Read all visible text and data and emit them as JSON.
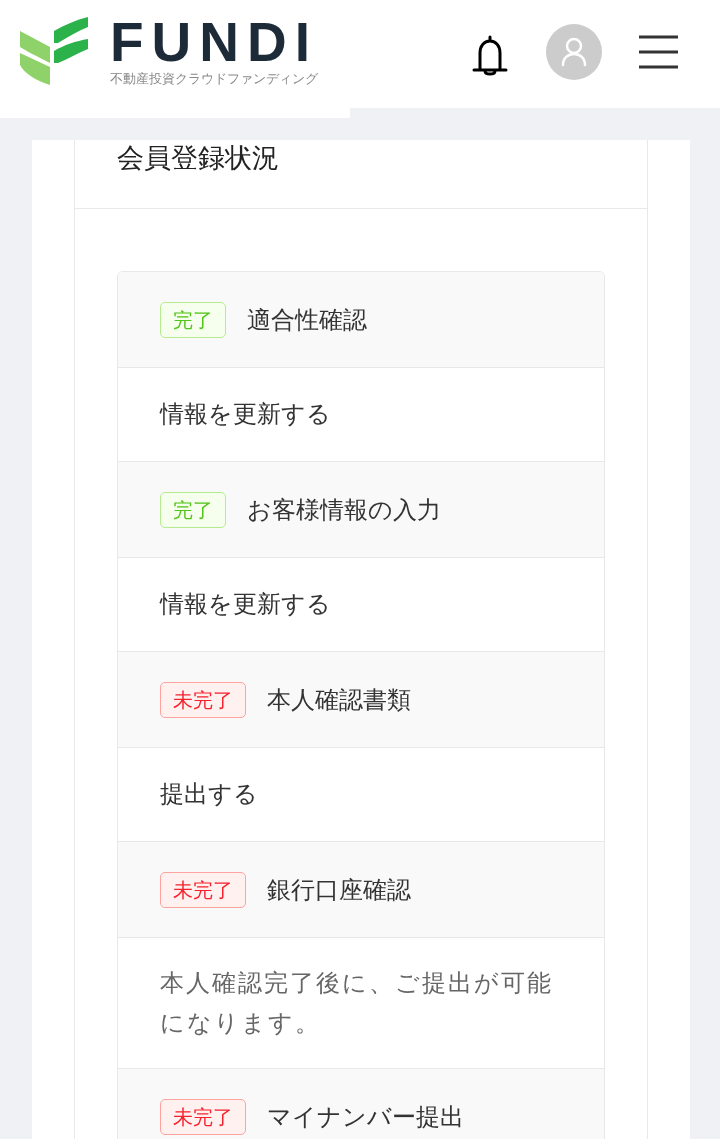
{
  "header": {
    "logo": {
      "wordmark": "FUNDI",
      "tagline": "不動産投資クラウドファンディング"
    }
  },
  "section": {
    "title": "会員登録状況"
  },
  "steps": [
    {
      "complete": true,
      "badge": "完了",
      "title": "適合性確認",
      "body": {
        "kind": "action",
        "text": "情報を更新する"
      }
    },
    {
      "complete": true,
      "badge": "完了",
      "title": "お客様情報の入力",
      "body": {
        "kind": "action",
        "text": "情報を更新する"
      }
    },
    {
      "complete": false,
      "badge": "未完了",
      "title": "本人確認書類",
      "body": {
        "kind": "action",
        "text": "提出する"
      }
    },
    {
      "complete": false,
      "badge": "未完了",
      "title": "銀行口座確認",
      "body": {
        "kind": "note",
        "text": "本人確認完了後に、ご提出が可能になります。"
      }
    },
    {
      "complete": false,
      "badge": "未完了",
      "title": "マイナンバー提出"
    }
  ]
}
